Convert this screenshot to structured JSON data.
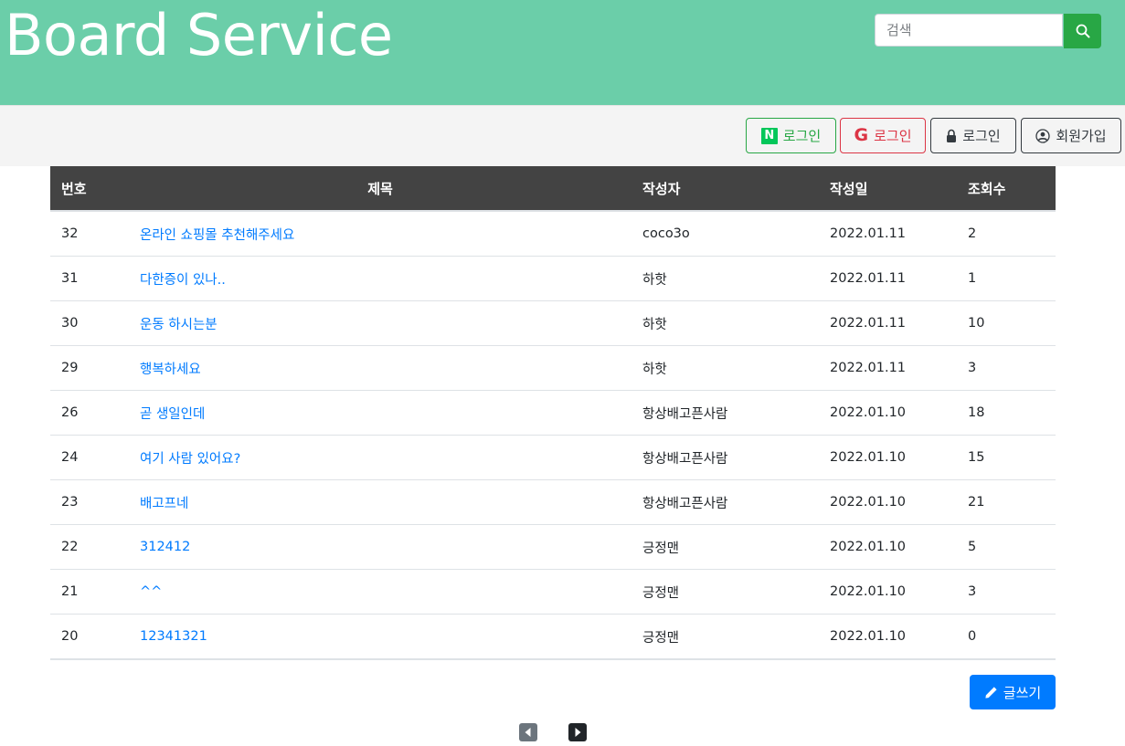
{
  "header": {
    "brand": "Board Service",
    "search_placeholder": "검색",
    "accent": "#6bcea9"
  },
  "auth": {
    "naver_logo": "N",
    "naver_label": "로그인",
    "google_logo": "G",
    "google_label": "로그인",
    "local_label": "로그인",
    "join_label": "회원가입"
  },
  "table": {
    "columns": [
      "번호",
      "제목",
      "작성자",
      "작성일",
      "조회수"
    ],
    "rows": [
      {
        "no": "32",
        "title": "온라인 쇼핑몰 추천해주세요",
        "author": "coco3o",
        "date": "2022.01.11",
        "views": "2"
      },
      {
        "no": "31",
        "title": "다한증이 있나..",
        "author": "하핫",
        "date": "2022.01.11",
        "views": "1"
      },
      {
        "no": "30",
        "title": "운동 하시는분",
        "author": "하핫",
        "date": "2022.01.11",
        "views": "10"
      },
      {
        "no": "29",
        "title": "행복하세요",
        "author": "하핫",
        "date": "2022.01.11",
        "views": "3"
      },
      {
        "no": "26",
        "title": "곧 생일인데",
        "author": "항상배고픈사람",
        "date": "2022.01.10",
        "views": "18"
      },
      {
        "no": "24",
        "title": "여기 사람 있어요?",
        "author": "항상배고픈사람",
        "date": "2022.01.10",
        "views": "15"
      },
      {
        "no": "23",
        "title": "배고프네",
        "author": "항상배고픈사람",
        "date": "2022.01.10",
        "views": "21"
      },
      {
        "no": "22",
        "title": "312412",
        "author": "긍정맨",
        "date": "2022.01.10",
        "views": "5"
      },
      {
        "no": "21",
        "title": "^^",
        "author": "긍정맨",
        "date": "2022.01.10",
        "views": "3"
      },
      {
        "no": "20",
        "title": "12341321",
        "author": "긍정맨",
        "date": "2022.01.10",
        "views": "0"
      }
    ]
  },
  "actions": {
    "write_label": "글쓰기"
  },
  "pagination": {
    "prev_icon": "caret-left-square-icon",
    "next_icon": "caret-right-square-icon"
  }
}
